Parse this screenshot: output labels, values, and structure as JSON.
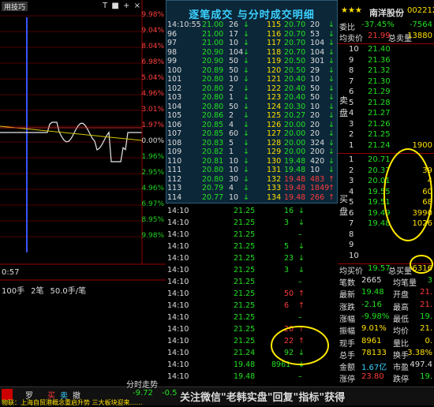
{
  "chart": {
    "label": "用技巧",
    "menu_icons": [
      "T",
      "■",
      "+",
      "×"
    ],
    "pct_labels": [
      {
        "text": "9.98%",
        "c": "r"
      },
      {
        "text": "9.04%",
        "c": "r"
      },
      {
        "text": "8.04%",
        "c": "r"
      },
      {
        "text": "6.98%",
        "c": "r"
      },
      {
        "text": "5.04%",
        "c": "r"
      },
      {
        "text": "4.96%",
        "c": "r"
      },
      {
        "text": "3.01%",
        "c": "r"
      },
      {
        "text": "1.97%",
        "c": "r"
      },
      {
        "text": "0.00%",
        "c": "w"
      },
      {
        "text": "1.96%",
        "c": "g"
      },
      {
        "text": "2.95%",
        "c": "g"
      },
      {
        "text": "4.96%",
        "c": "g"
      },
      {
        "text": "6.97%",
        "c": "g"
      },
      {
        "text": "8.95%",
        "c": "g"
      },
      {
        "text": "9.98%",
        "c": "g"
      }
    ],
    "time": "0:57",
    "vol_row": [
      "100手",
      "2笔",
      "50.0手/笔"
    ]
  },
  "tick": {
    "title": "逐笔成交 与分时成交明细",
    "rows": [
      {
        "t": "14:10:55",
        "p": "21.00",
        "v": "26",
        "d": "d",
        "n": "115",
        "p2": "20.70",
        "v2": "20",
        "d2": "d"
      },
      {
        "t": "96",
        "p": "21.00",
        "v": "17",
        "d": "d",
        "n": "116",
        "p2": "20.70",
        "v2": "53",
        "d2": "d"
      },
      {
        "t": "97",
        "p": "21.00",
        "v": "10",
        "d": "d",
        "n": "117",
        "p2": "20.70",
        "v2": "104",
        "d2": "d"
      },
      {
        "t": "98",
        "p": "20.90",
        "v": "104",
        "d": "d",
        "n": "118",
        "p2": "20.70",
        "v2": "104",
        "d2": "d"
      },
      {
        "t": "99",
        "p": "20.90",
        "v": "50",
        "d": "d",
        "n": "119",
        "p2": "20.50",
        "v2": "301",
        "d2": "d"
      },
      {
        "t": "100",
        "p": "20.89",
        "v": "50",
        "d": "d",
        "n": "120",
        "p2": "20.50",
        "v2": "29",
        "d2": "d"
      },
      {
        "t": "101",
        "p": "20.80",
        "v": "10",
        "d": "d",
        "n": "121",
        "p2": "20.40",
        "v2": "10",
        "d2": "d"
      },
      {
        "t": "102",
        "p": "20.80",
        "v": "2",
        "d": "d",
        "n": "122",
        "p2": "20.40",
        "v2": "50",
        "d2": "d"
      },
      {
        "t": "103",
        "p": "20.80",
        "v": "1",
        "d": "d",
        "n": "123",
        "p2": "20.40",
        "v2": "50",
        "d2": "d"
      },
      {
        "t": "104",
        "p": "20.80",
        "v": "50",
        "d": "d",
        "n": "124",
        "p2": "20.30",
        "v2": "10",
        "d2": "d"
      },
      {
        "t": "105",
        "p": "20.86",
        "v": "2",
        "d": "d",
        "n": "125",
        "p2": "20.27",
        "v2": "20",
        "d2": "d"
      },
      {
        "t": "106",
        "p": "20.85",
        "v": "4",
        "d": "d",
        "n": "126",
        "p2": "20.00",
        "v2": "20",
        "d2": "d"
      },
      {
        "t": "107",
        "p": "20.85",
        "v": "60",
        "d": "d",
        "n": "127",
        "p2": "20.00",
        "v2": "20",
        "d2": "d"
      },
      {
        "t": "108",
        "p": "20.83",
        "v": "5",
        "d": "d",
        "n": "128",
        "p2": "20.00",
        "v2": "324",
        "d2": "d"
      },
      {
        "t": "109",
        "p": "20.82",
        "v": "1",
        "d": "d",
        "n": "129",
        "p2": "20.00",
        "v2": "200",
        "d2": "d"
      },
      {
        "t": "110",
        "p": "20.81",
        "v": "10",
        "d": "d",
        "n": "130",
        "p2": "19.48",
        "v2": "420",
        "d2": "d"
      },
      {
        "t": "111",
        "p": "20.80",
        "v": "10",
        "d": "d",
        "n": "131",
        "p2": "19.48",
        "v2": "10",
        "d2": "d"
      },
      {
        "t": "112",
        "p": "20.80",
        "v": "30",
        "d": "d",
        "n": "132",
        "p2": "19.48",
        "v2": "483",
        "d2": "u"
      },
      {
        "t": "113",
        "p": "20.79",
        "v": "4",
        "d": "d",
        "n": "133",
        "p2": "19.48",
        "v2": "1849",
        "d2": "u"
      },
      {
        "t": "114",
        "p": "20.77",
        "v": "10",
        "d": "d",
        "n": "134",
        "p2": "19.48",
        "v2": "266",
        "d2": "u"
      }
    ],
    "minute_rows": [
      {
        "t": "14:10",
        "p": "21.25",
        "v": "16",
        "d": "d"
      },
      {
        "t": "14:10",
        "p": "21.25",
        "v": "3",
        "d": "d"
      },
      {
        "t": "14:10",
        "p": "21.25",
        "v": "",
        "d": ""
      },
      {
        "t": "14:10",
        "p": "21.25",
        "v": "5",
        "d": "d"
      },
      {
        "t": "14:10",
        "p": "21.25",
        "v": "23",
        "d": "d"
      },
      {
        "t": "14:10",
        "p": "21.25",
        "v": "3",
        "d": "d"
      },
      {
        "t": "14:10",
        "p": "21.25",
        "v": "",
        "d": ""
      },
      {
        "t": "14:10",
        "p": "21.25",
        "v": "50",
        "d": "u"
      },
      {
        "t": "14:10",
        "p": "21.25",
        "v": "6",
        "d": "u"
      },
      {
        "t": "14:10",
        "p": "21.25",
        "v": "",
        "d": ""
      },
      {
        "t": "14:10",
        "p": "21.25",
        "v": "20",
        "d": "u"
      },
      {
        "t": "14:10",
        "p": "21.25",
        "v": "22",
        "d": "u"
      },
      {
        "t": "14:10",
        "p": "21.24",
        "v": "92",
        "d": "d"
      },
      {
        "t": "14:10",
        "p": "19.48",
        "v": "8961",
        "d": "d"
      },
      {
        "t": "14:10",
        "p": "19.48",
        "v": "",
        "d": ""
      }
    ]
  },
  "quote": {
    "stars": "★★★",
    "name": "南洋股份",
    "code": "002212",
    "webi_label": "委比",
    "webi": "-37.45%",
    "webi_diff": "-7564",
    "avg_sell_label": "均卖价",
    "avg_sell": "21.99",
    "total_sell_label": "总卖量",
    "total_sell": "13880",
    "sell_side_label": "卖盘",
    "sell_levels": [
      {
        "n": "10",
        "p": "21.40",
        "v": ""
      },
      {
        "n": "9",
        "p": "21.36",
        "v": ""
      },
      {
        "n": "8",
        "p": "21.32",
        "v": ""
      },
      {
        "n": "7",
        "p": "21.30",
        "v": ""
      },
      {
        "n": "6",
        "p": "21.29",
        "v": ""
      },
      {
        "n": "5",
        "p": "21.28",
        "v": ""
      },
      {
        "n": "4",
        "p": "21.27",
        "v": ""
      },
      {
        "n": "3",
        "p": "21.26",
        "v": ""
      },
      {
        "n": "2",
        "p": "21.25",
        "v": ""
      },
      {
        "n": "1",
        "p": "21.24",
        "v": "1900"
      }
    ],
    "buy_side_label": "买盘",
    "buy_levels": [
      {
        "n": "1",
        "p": "20.71",
        "v": ""
      },
      {
        "n": "2",
        "p": "20.37",
        "v": "39"
      },
      {
        "n": "3",
        "p": "20.01",
        "v": "4"
      },
      {
        "n": "4",
        "p": "19.55",
        "v": "60"
      },
      {
        "n": "5",
        "p": "19.51",
        "v": "68"
      },
      {
        "n": "6",
        "p": "19.49",
        "v": "3990"
      },
      {
        "n": "7",
        "p": "19.48",
        "v": "1026"
      },
      {
        "n": "8",
        "p": "",
        "v": ""
      },
      {
        "n": "9",
        "p": "",
        "v": ""
      },
      {
        "n": "10",
        "p": "",
        "v": ""
      }
    ],
    "avg_buy_label": "均买价",
    "avg_buy": "19.57",
    "total_buy_label": "总买量",
    "total_buy": "6316",
    "stats": [
      {
        "k": "笔数",
        "v": "2665",
        "k2": "均笔量",
        "v2": "3",
        "c": "w",
        "c2": "g"
      },
      {
        "k": "最新",
        "v": "19.48",
        "k2": "开盘",
        "v2": "21.",
        "c": "g",
        "c2": "r"
      },
      {
        "k": "涨跌",
        "v": "-2.16",
        "k2": "最高",
        "v2": "21.",
        "c": "g",
        "c2": "r"
      },
      {
        "k": "涨幅",
        "v": "-9.98%",
        "k2": "最低",
        "v2": "19.",
        "c": "g",
        "c2": "g"
      },
      {
        "k": "振幅",
        "v": "9.01%",
        "k2": "均价",
        "v2": "21.",
        "c": "y",
        "c2": "y"
      },
      {
        "k": "现手",
        "v": "8961",
        "k2": "量比",
        "v2": "0.",
        "c": "y",
        "c2": "y"
      },
      {
        "k": "总手",
        "v": "78133",
        "k2": "换手",
        "v2": "3.38%",
        "c": "y",
        "c2": "y"
      },
      {
        "k": "金额",
        "v": "1.67亿",
        "k2": "市盈",
        "v2": "497.4",
        "c": "c",
        "c2": "w"
      },
      {
        "k": "涨停",
        "v": "23.80",
        "k2": "跌停",
        "v2": "19.",
        "c": "r",
        "c2": "g"
      }
    ]
  },
  "bottom": {
    "tabs": [
      "罗",
      "买",
      "卖",
      "撤"
    ],
    "tab_time": "分时走势",
    "change": "-9.72",
    "change2": "-0.5",
    "ticker": "物联：上海自贸港概念重启升势 三大板块迎来……",
    "watermark": "关注微信\"老韩实盘\"回复\"指标\"获得"
  }
}
